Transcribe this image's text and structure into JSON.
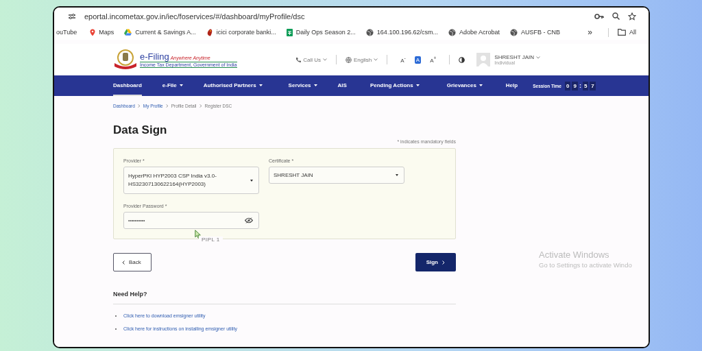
{
  "browser": {
    "url": "eportal.incometax.gov.in/iec/foservices/#/dashboard/myProfile/dsc",
    "bookmarks": [
      {
        "label": "ouTube",
        "kind": "text"
      },
      {
        "label": "Maps",
        "kind": "maps"
      },
      {
        "label": "Current & Savings A...",
        "kind": "drive"
      },
      {
        "label": "icici corporate banki...",
        "kind": "icici"
      },
      {
        "label": "Daily Ops Season 2...",
        "kind": "sheets"
      },
      {
        "label": "164.100.196.62/csm...",
        "kind": "globe"
      },
      {
        "label": "Adobe Acrobat",
        "kind": "globe"
      },
      {
        "label": "AUSFB - CNB",
        "kind": "globe"
      }
    ],
    "more": "»",
    "all_bookmarks": "All"
  },
  "header": {
    "logo_title": "e-Filing",
    "logo_tagline": "Anywhere Anytime",
    "logo_subtitle": "Income Tax Department, Government of India",
    "call_us": "Call Us",
    "language": "English",
    "font_sizes": [
      {
        "label": "A$^{-}$",
        "selected": false
      },
      {
        "label": "A",
        "selected": true
      },
      {
        "label": "A$^{+}$",
        "selected": false
      }
    ],
    "user": {
      "name": "SHRESHT JAIN",
      "role": "Individual"
    }
  },
  "nav": {
    "items": [
      {
        "label": "Dashboard",
        "dropdown": false,
        "selected": true
      },
      {
        "label": "e-File",
        "dropdown": true,
        "selected": false
      },
      {
        "label": "Authorised Partners",
        "dropdown": true,
        "selected": false
      },
      {
        "label": "Services",
        "dropdown": true,
        "selected": false
      },
      {
        "label": "AIS",
        "dropdown": false,
        "selected": false
      },
      {
        "label": "Pending Actions",
        "dropdown": true,
        "selected": false
      },
      {
        "label": "Grievances",
        "dropdown": true,
        "selected": false
      },
      {
        "label": "Help",
        "dropdown": false,
        "selected": false
      }
    ],
    "session": {
      "label": "Session Time",
      "parts": [
        {
          "text": "0",
          "kind": "digit"
        },
        {
          "text": "9",
          "kind": "digit"
        },
        {
          "text": ":",
          "kind": "sep"
        },
        {
          "text": "5",
          "kind": "digit"
        },
        {
          "text": "7",
          "kind": "digit"
        }
      ]
    }
  },
  "breadcrumbs": [
    {
      "label": "Dashboard",
      "link": true
    },
    {
      "label": "My Profile",
      "link": true
    },
    {
      "label": "Profile Detail",
      "link": false
    },
    {
      "label": "Register DSC",
      "link": false
    }
  ],
  "title": "Data Sign",
  "mandatory_note": "* indicates mandatory fields",
  "form": {
    "provider": {
      "label": "Provider *",
      "value": "HyperPKI HYP2003 CSP India v3.0-HS32307130622164(HYP2003)"
    },
    "certificate": {
      "label": "Certificate *",
      "value": "SHRESHT JAIN"
    },
    "password": {
      "label": "Provider Password *",
      "value": "••••••••••"
    },
    "tag": "PIPL 1"
  },
  "buttons": {
    "back": "Back",
    "sign": "Sign"
  },
  "help": {
    "title": "Need Help?",
    "links": [
      "Click here to download emsigner utility",
      "Click here for instructions on installing emsigner utility"
    ]
  },
  "os_notice": {
    "title": "Activate Windows",
    "subtitle": "Go to Settings to activate Windo"
  }
}
